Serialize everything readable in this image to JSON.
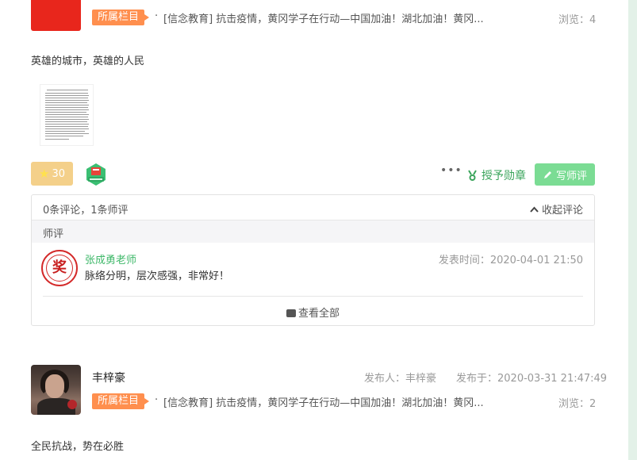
{
  "post1": {
    "category_tag": "所属栏目",
    "category_link": "[信念教育] 抗击疫情，黄冈学子在行动—中国加油！湖北加油！黄冈...",
    "views": "浏览：4",
    "text": "英雄的城市，英雄的人民",
    "likes": "30",
    "more": "•••",
    "medal_label": "授予勋章",
    "write_review_label": "写师评",
    "badge_icon": "book-badge-icon",
    "comments": {
      "summary": "0条评论，1条师评",
      "collapse_label": "收起评论",
      "section_label": "师评",
      "review": {
        "teacher": "张成勇老师",
        "time": "发表时间：2020-04-01 21:50",
        "text": "脉络分明，层次感强，非常好！"
      },
      "view_all_label": "查看全部"
    }
  },
  "post2": {
    "author": "丰梓豪",
    "publisher": "发布人：丰梓豪",
    "published_at": "发布于：2020-03-31 21:47:49",
    "category_tag": "所属栏目",
    "category_link": "[信念教育] 抗击疫情，黄冈学子在行动—中国加油！湖北加油！黄冈...",
    "views": "浏览：2",
    "text": "全民抗战，势在必胜"
  },
  "colors": {
    "page_bg": "#e3f1e8",
    "tag_orange": "#ff8f4e",
    "accent_green": "#3fb86a",
    "write_button": "#7bdc94",
    "like_button": "#f4d08a"
  }
}
